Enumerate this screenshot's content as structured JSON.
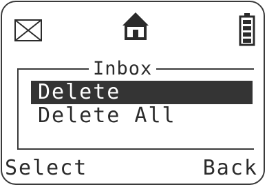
{
  "status_bar": {
    "icons": [
      "envelope-icon",
      "home-icon",
      "battery-icon"
    ]
  },
  "menu": {
    "title": "Inbox",
    "items": [
      {
        "label": "Delete",
        "selected": true
      },
      {
        "label": "Delete All",
        "selected": false
      }
    ]
  },
  "softkeys": {
    "left": "Select",
    "right": "Back"
  },
  "colors": {
    "text": "#2b2b2b",
    "highlight": "#343434",
    "highlight_text": "#ffffff",
    "background": "#ffffff"
  }
}
